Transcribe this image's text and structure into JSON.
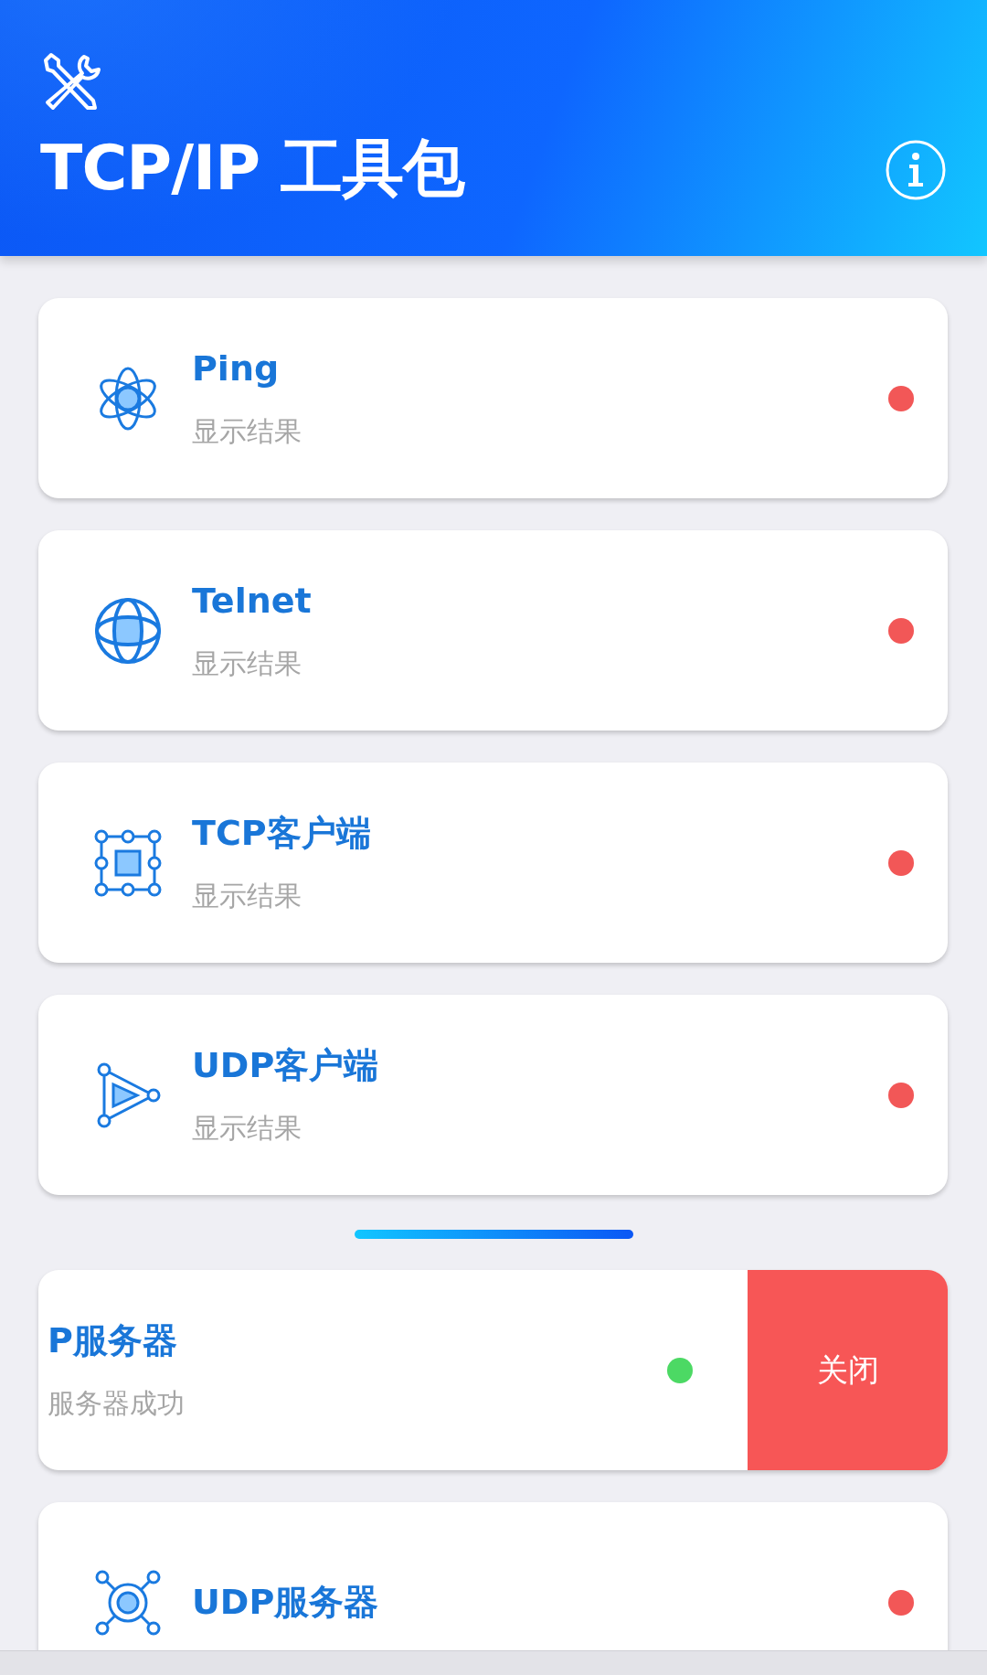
{
  "header": {
    "title": "TCP/IP 工具包"
  },
  "tools": [
    {
      "kind": "tool",
      "title": "Ping",
      "subtitle": "显示结果",
      "color": "#f25757"
    },
    {
      "kind": "tool",
      "title": "Telnet",
      "subtitle": "显示结果",
      "color": "#f25757"
    },
    {
      "kind": "tool",
      "title": "TCP客户端",
      "subtitle": "显示结果",
      "color": "#f25757"
    },
    {
      "kind": "tool",
      "title": "UDP客户端",
      "subtitle": "显示结果",
      "color": "#f25757"
    }
  ],
  "servers": [
    {
      "kind": "swiped",
      "title": "P服务器",
      "subtitle": "服务器成功",
      "color": "#4cd964",
      "action": "关闭"
    },
    {
      "kind": "tool",
      "title": "UDP服务器",
      "color": "#f25757"
    }
  ]
}
